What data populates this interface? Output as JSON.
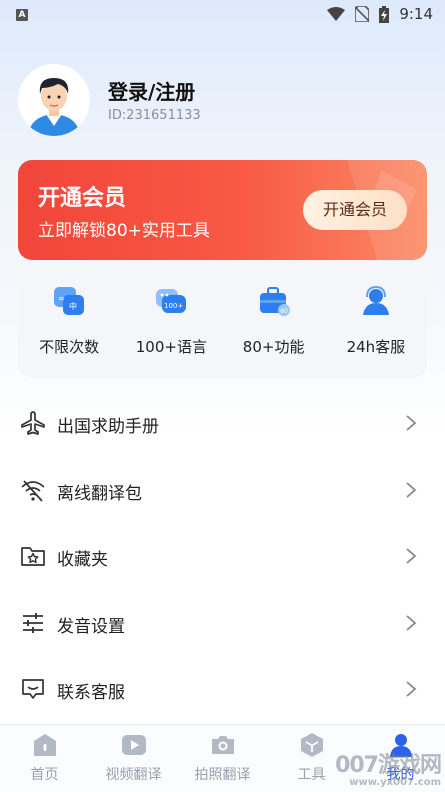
{
  "status_bar": {
    "left_glyph": "A",
    "time": "9:14"
  },
  "profile": {
    "name": "登录/注册",
    "id": "ID:231651133"
  },
  "vip": {
    "title": "开通会员",
    "subtitle": "立即解锁80+实用工具",
    "button": "开通会员",
    "features": [
      {
        "label": "不限次数",
        "icon": "infinity-icon"
      },
      {
        "label": "100+语言",
        "icon": "language-icon"
      },
      {
        "label": "80+功能",
        "icon": "toolbox-icon"
      },
      {
        "label": "24h客服",
        "icon": "support-icon"
      }
    ]
  },
  "menu": [
    {
      "label": "出国求助手册",
      "icon": "airplane-icon"
    },
    {
      "label": "离线翻译包",
      "icon": "wifi-off-icon"
    },
    {
      "label": "收藏夹",
      "icon": "folder-star-icon"
    },
    {
      "label": "发音设置",
      "icon": "sliders-icon"
    },
    {
      "label": "联系客服",
      "icon": "chat-icon"
    }
  ],
  "tabs": [
    {
      "label": "首页",
      "icon": "home-icon",
      "active": false
    },
    {
      "label": "视频翻译",
      "icon": "video-icon",
      "active": false
    },
    {
      "label": "拍照翻译",
      "icon": "camera-icon",
      "active": false
    },
    {
      "label": "工具",
      "icon": "cube-icon",
      "active": false
    },
    {
      "label": "我的",
      "icon": "person-icon",
      "active": true
    }
  ],
  "watermark": {
    "main": "007游戏网",
    "sub": "www.yx007.com"
  },
  "colors": {
    "accent": "#2a62e8",
    "vip_red": "#f2453b",
    "inactive": "#9aa1ad"
  }
}
